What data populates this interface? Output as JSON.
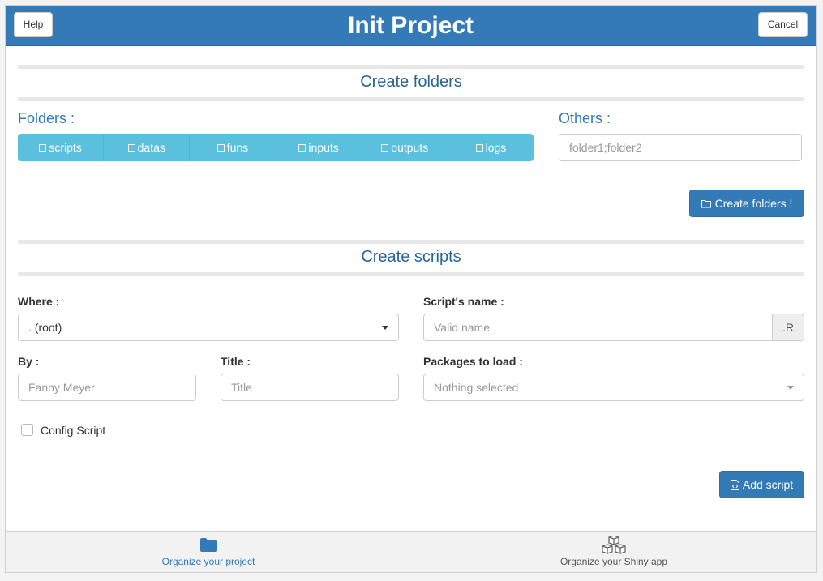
{
  "header": {
    "title": "Init Project",
    "help_label": "Help",
    "cancel_label": "Cancel"
  },
  "create_folders": {
    "section_title": "Create folders",
    "folders_label": "Folders :",
    "folder_buttons": [
      "scripts",
      "datas",
      "funs",
      "inputs",
      "outputs",
      "logs"
    ],
    "others_label": "Others :",
    "others_placeholder": "folder1;folder2",
    "create_button_label": "Create folders !"
  },
  "create_scripts": {
    "section_title": "Create scripts",
    "where_label": "Where :",
    "where_value": ". (root)",
    "script_name_label": "Script's name :",
    "script_name_placeholder": "Valid name",
    "script_ext": ".R",
    "by_label": "By :",
    "by_placeholder": "Fanny Meyer",
    "title_label": "Title :",
    "title_placeholder": "Title",
    "packages_label": "Packages to load :",
    "packages_placeholder": "Nothing selected",
    "config_label": "Config Script",
    "add_button_label": "Add script"
  },
  "footer": {
    "tabs": [
      {
        "label": "Organize your project",
        "icon": "folder-icon",
        "active": true
      },
      {
        "label": "Organize your Shiny app",
        "icon": "cubes-icon",
        "active": false
      }
    ]
  },
  "colors": {
    "primary": "#337ab7",
    "info": "#5bc0de",
    "section_title": "#2a6496"
  }
}
